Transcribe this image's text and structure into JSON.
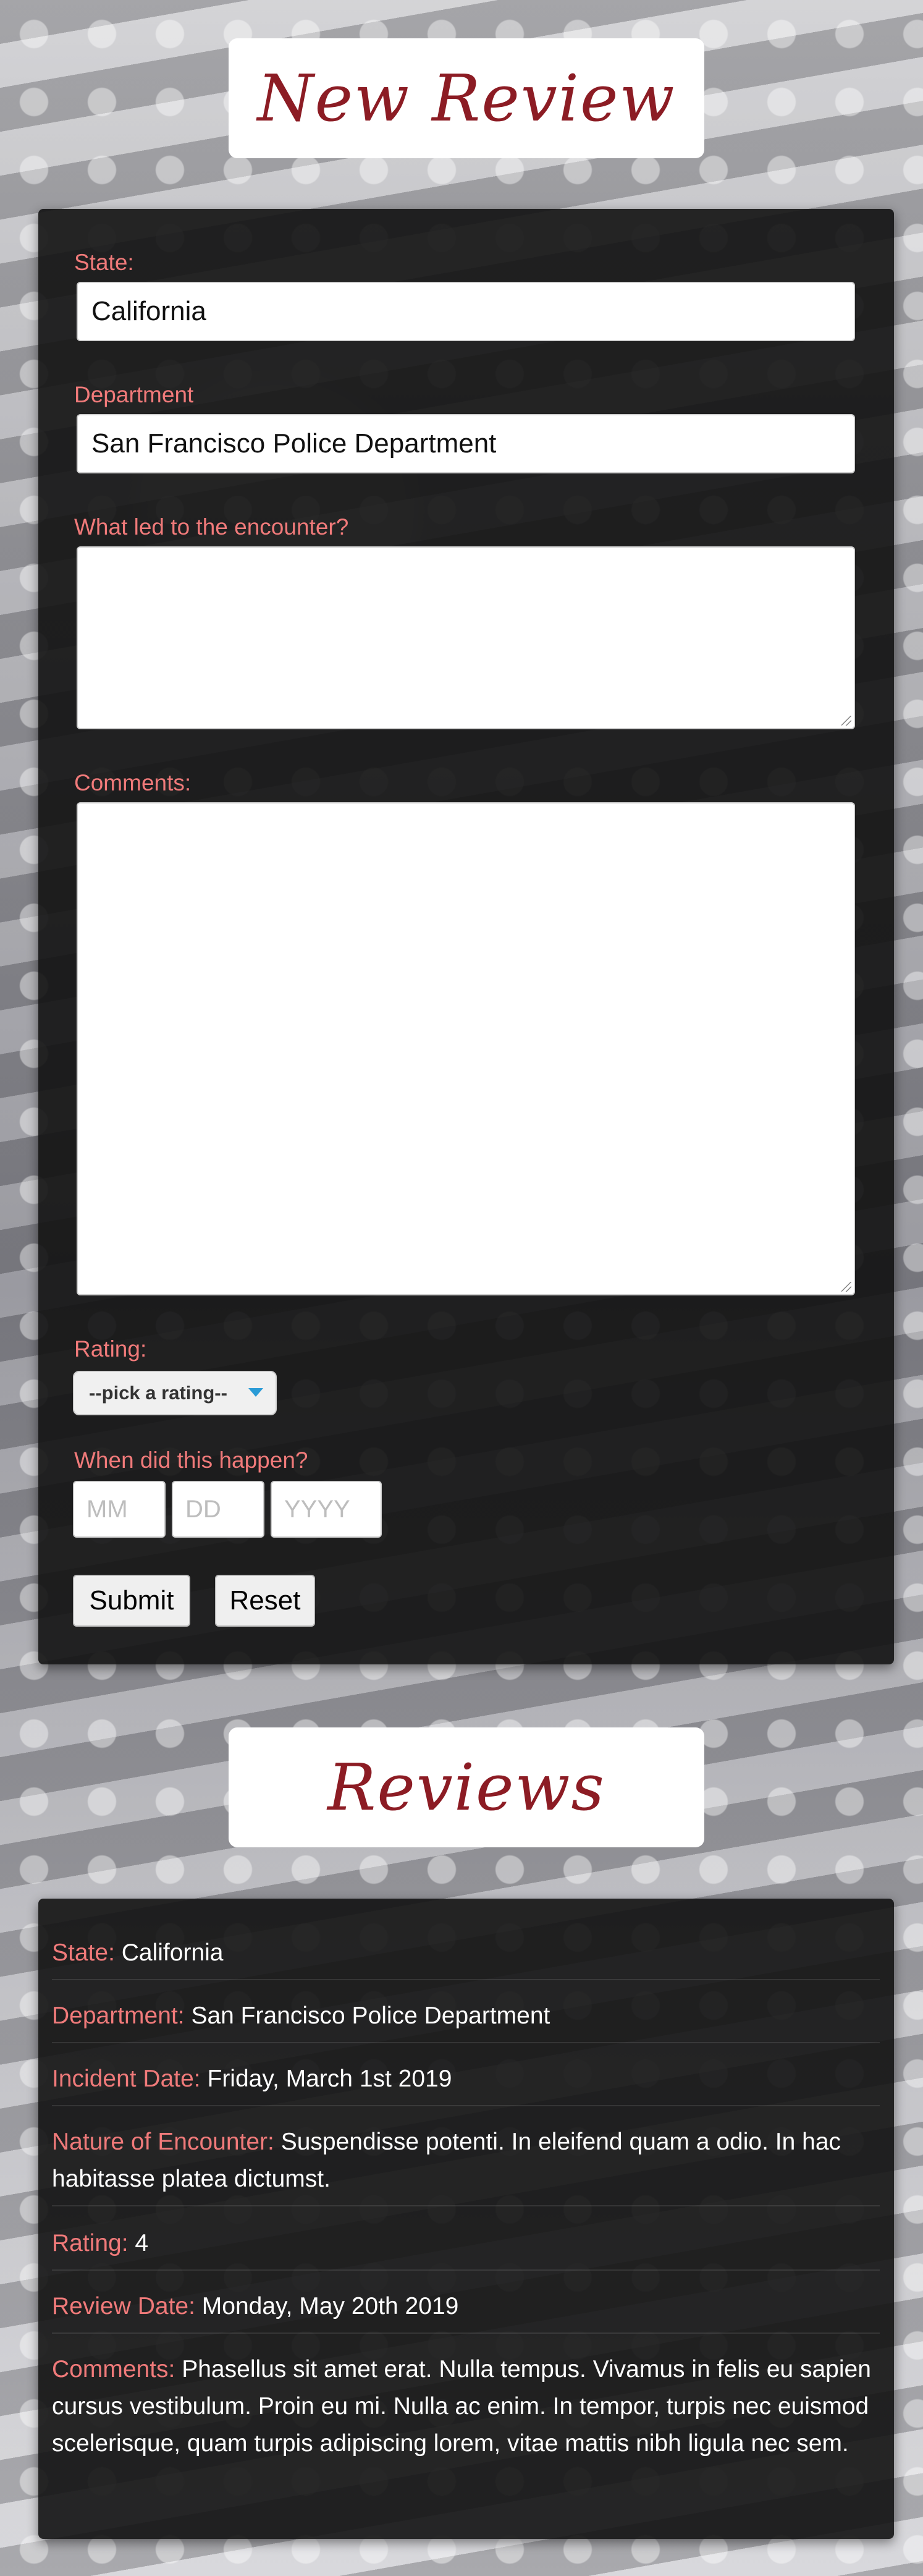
{
  "form_section": {
    "title": "New Review",
    "state_label": "State:",
    "state_value": "California",
    "department_label": "Department",
    "department_value": "San Francisco Police Department",
    "encounter_label": "What led to the encounter?",
    "encounter_value": "",
    "comments_label": "Comments:",
    "comments_value": "",
    "rating_label": "Rating:",
    "rating_selected": "--pick a rating--",
    "date_label": "When did this happen?",
    "date_placeholders": {
      "month": "MM",
      "day": "DD",
      "year": "YYYY"
    },
    "submit_label": "Submit",
    "reset_label": "Reset"
  },
  "reviews_section": {
    "title": "Reviews",
    "review": {
      "state_key": "State:",
      "state": "California",
      "department_key": "Department:",
      "department": "San Francisco Police Department",
      "incident_key": "Incident Date:",
      "incident_date": "Friday, March 1st 2019",
      "nature_key": "Nature of Encounter:",
      "nature": "Suspendisse potenti. In eleifend quam a odio. In hac habitasse platea dictumst.",
      "rating_key": "Rating:",
      "rating": "4",
      "review_date_key": "Review Date:",
      "review_date": "Monday, May 20th 2019",
      "comments_key": "Comments:",
      "comments": "Phasellus sit amet erat. Nulla tempus. Vivamus in felis eu sapien cursus vestibulum. Proin eu mi. Nulla ac enim. In tempor, turpis nec euismod scelerisque, quam turpis adipiscing lorem, vitae mattis nibh ligula nec sem."
    }
  },
  "colors": {
    "accent_label": "#f07a7a",
    "title_red": "#8c1c24",
    "panel": "#121212",
    "select_caret": "#2a9bd6"
  }
}
